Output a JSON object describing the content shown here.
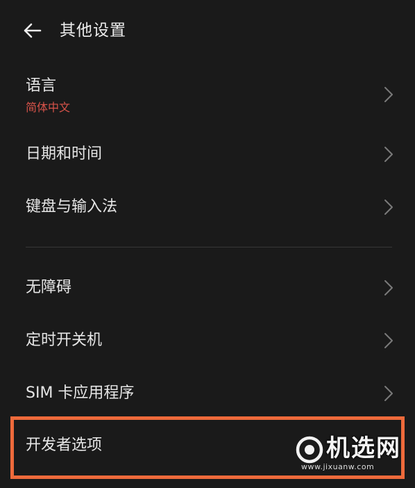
{
  "header": {
    "title": "其他设置",
    "back_icon": "arrow-left-icon"
  },
  "settings": {
    "items": [
      {
        "label": "语言",
        "sub": "简体中文"
      },
      {
        "label": "日期和时间"
      },
      {
        "label": "键盘与输入法"
      },
      {
        "label": "无障碍"
      },
      {
        "label": "定时开关机"
      },
      {
        "label": "SIM 卡应用程序"
      },
      {
        "label": "开发者选项"
      }
    ]
  },
  "watermark": {
    "name": "机选网",
    "url": "www.jixuanw.com"
  },
  "colors": {
    "background": "#1a1a1a",
    "text": "#e6e6e6",
    "subtitle": "#d8534a",
    "highlight": "#ee6a3b",
    "chevron": "#7a7a7a"
  }
}
